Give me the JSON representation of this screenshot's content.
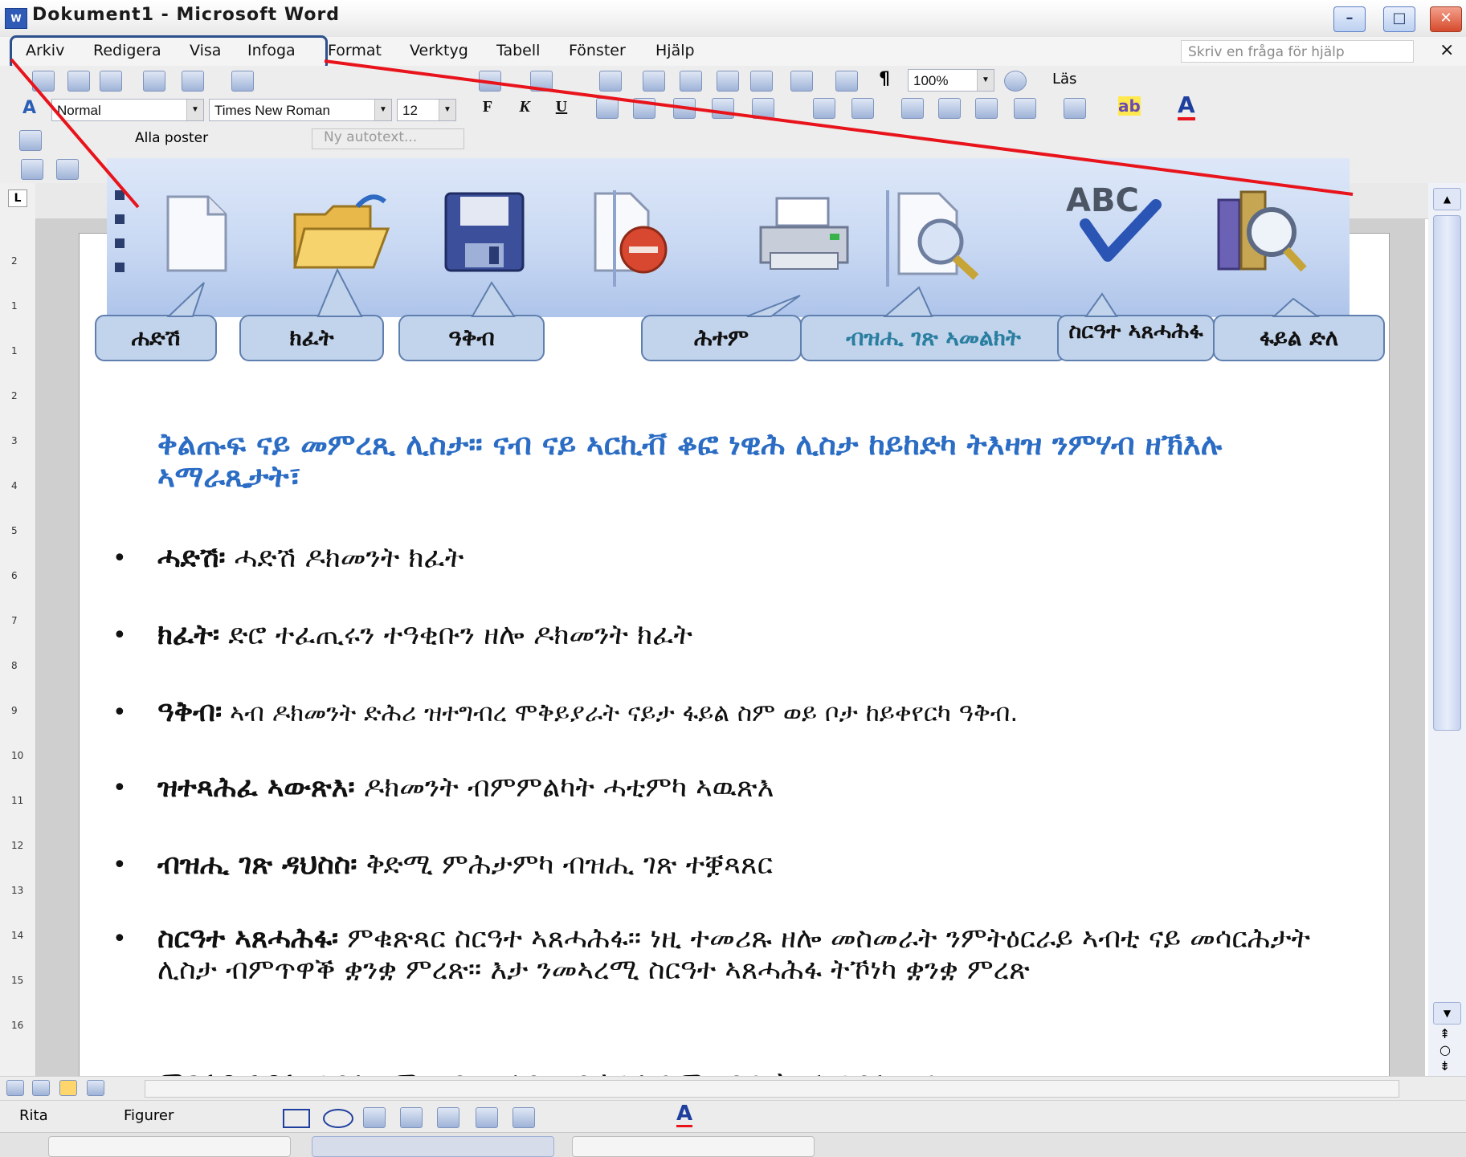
{
  "window": {
    "title": "Dokument1 - Microsoft Word",
    "app_icon": "word-icon",
    "buttons": [
      "minimize",
      "maximize",
      "close"
    ]
  },
  "menu": {
    "items": [
      "Arkiv",
      "Redigera",
      "Visa",
      "Infoga",
      "Format",
      "Verktyg",
      "Tabell",
      "Fönster",
      "Hjälp"
    ],
    "help_placeholder": "Skriv en fråga för hjälp",
    "close_glyph": "×"
  },
  "standard_toolbar": {
    "zoom": "100%",
    "read_label": "Läs",
    "pilcrow": "¶"
  },
  "formatting_toolbar": {
    "style": "Normal",
    "font": "Times New Roman",
    "size": "12",
    "bold": "F",
    "italic": "K",
    "underline": "U",
    "highlight_label": "ab",
    "font_color_label": "A"
  },
  "autotext_toolbar": {
    "entries": "Alla poster",
    "new_autotext": "Ny autotext..."
  },
  "ruler": {
    "tab_selector": "L",
    "vertical_marks": [
      "2",
      "1",
      "1",
      "2",
      "3",
      "4",
      "5",
      "6",
      "7",
      "8",
      "9",
      "10",
      "11",
      "12",
      "13",
      "14",
      "15",
      "16"
    ]
  },
  "zoomed_toolbar": {
    "icons": [
      "new-document-icon",
      "open-folder-icon",
      "save-disk-icon",
      "permission-icon",
      "print-icon",
      "print-preview-icon",
      "spelling-check-icon",
      "research-icon"
    ],
    "callouts": [
      {
        "label": "ሐድሽ"
      },
      {
        "label": "ክፈት"
      },
      {
        "label": "ዓቅብ"
      },
      {
        "label": "ሕተም"
      },
      {
        "label": "ብዝሒ ገጽ ኣመልክት"
      },
      {
        "label": "ስርዓተ ኣጸሓሕፋ"
      },
      {
        "label": "ፋይል ድለ"
      }
    ]
  },
  "content": {
    "heading": "ቅልጡፍ ናይ መምረጺ ሊስታ። ናብ ናይ ኣርኪቭ ቆፎ ነዊሕ ሊስታ ከይከድካ ትእዛዝ ንምሃብ ዘኽእሉ ኣማራጺታት፣",
    "items": [
      {
        "term": "ሓድሽ፡",
        "desc": " ሓድሽ ዶክመንት ክፈት"
      },
      {
        "term": "ክፈት፡",
        "desc": " ድሮ ተፈጢሩን ተዓቂቡን ዘሎ ዶክመንት ክፈት"
      },
      {
        "term": "ዓቅብ፡",
        "desc": " ኣብ ዶክመንት ድሕሪ ዝተግብረ ሞቅይያራት ናይታ ፋይል ስም ወይ ቦታ ከይቀየርካ ዓቅብ."
      },
      {
        "term": "ዝተጻሕፈ ኣውጽእ፡",
        "desc": " ዶክመንት ብምምልካት ሓቲምካ ኣዉጽእ"
      },
      {
        "term": "ብዝሒ ገጽ ዳህስስ፡",
        "desc": " ቅድሚ ምሕታምካ ብዝሒ ገጽ ተቛጻጸር"
      },
      {
        "term": "ስርዓተ ኣጸሓሕፋ፡",
        "desc": " ምቁጽጻር ስርዓተ ኣጸሓሕፋ። ነዚ ተመሪጹ ዘሎ መስመራት ንምትዕርራይ ኣብቲ ናይ መሳርሕታት ሊስታ ብምጥዋቕ ቋንቋ ምረጽ። እታ ንመኣረሚ ስርዓተ ኣጸሓሕፋ ትኾነካ ቋንቋ ምረጽ"
      },
      {
        "term": "ምድላይ ፋይል፡",
        "desc": " ፋይል ንምንዳይ ሙሉእ ወይ ክፋል ስም ናይታ ትድለ ፋይል ጽሓፍ።"
      }
    ],
    "bullet": "•"
  },
  "drawing_toolbar": {
    "draw_label": "Rita",
    "shapes_label": "Figurer"
  },
  "colors": {
    "heading": "#2b6cc4",
    "callout_fill": "#c2d3ec",
    "callout_border": "#5f7fae",
    "red_lines": "#e8131b",
    "menu_highlight": "#2d4f8c"
  }
}
